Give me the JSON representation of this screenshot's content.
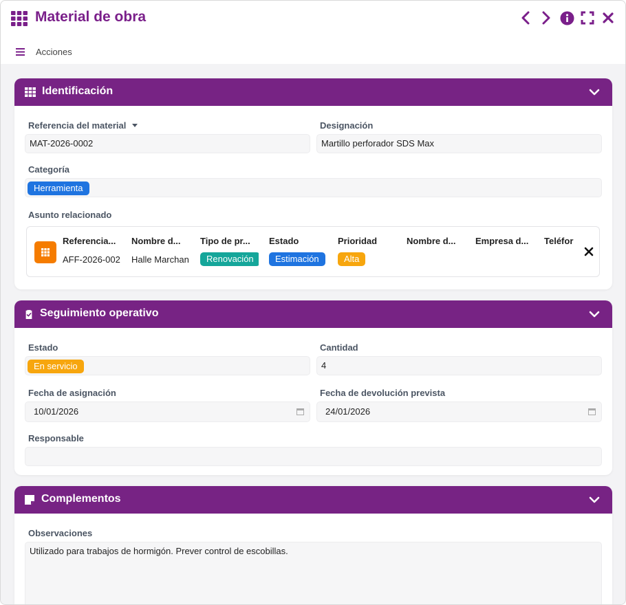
{
  "window": {
    "title": "Material de obra",
    "actions_label": "Acciones"
  },
  "icons": {
    "app": "grid-icon",
    "prev": "chevron-left-icon",
    "next": "chevron-right-icon",
    "info": "info-icon",
    "fullscreen": "fullscreen-icon",
    "close": "close-icon",
    "menu": "hamburger-menu-icon"
  },
  "colors": {
    "brand": "#772384",
    "title": "#7a1f8a",
    "tag_blue": "#1f74e0",
    "tag_teal": "#15a69a",
    "tag_orange": "#f7a60e",
    "related_icon": "#f57c00"
  },
  "identificacion": {
    "title": "Identificación",
    "ref_label": "Referencia del material",
    "ref_value": "MAT-2026-0002",
    "designacion_label": "Designación",
    "designacion_value": "Martillo perforador SDS Max",
    "categoria_label": "Categoría",
    "categoria_value": "Herramienta",
    "asunto_label": "Asunto relacionado",
    "asunto": {
      "headers": [
        "Referencia...",
        "Nombre d...",
        "Tipo de pr...",
        "Estado",
        "Prioridad",
        "Nombre d...",
        "Empresa d...",
        "Teléfor"
      ],
      "values": [
        "AFF-2026-002",
        "Halle Marchan",
        "Renovación",
        "Estimación",
        "Alta",
        "",
        "",
        ""
      ]
    }
  },
  "seguimiento": {
    "title": "Seguimiento operativo",
    "estado_label": "Estado",
    "estado_value": "En servicio",
    "cantidad_label": "Cantidad",
    "cantidad_value": "4",
    "fecha_asig_label": "Fecha de asignación",
    "fecha_asig_value": "10/01/2026",
    "fecha_dev_label": "Fecha de devolución prevista",
    "fecha_dev_value": "24/01/2026",
    "responsable_label": "Responsable",
    "responsable_value": ""
  },
  "complementos": {
    "title": "Complementos",
    "observaciones_label": "Observaciones",
    "observaciones_value": "Utilizado para trabajos de hormigón. Prever control de escobillas."
  }
}
